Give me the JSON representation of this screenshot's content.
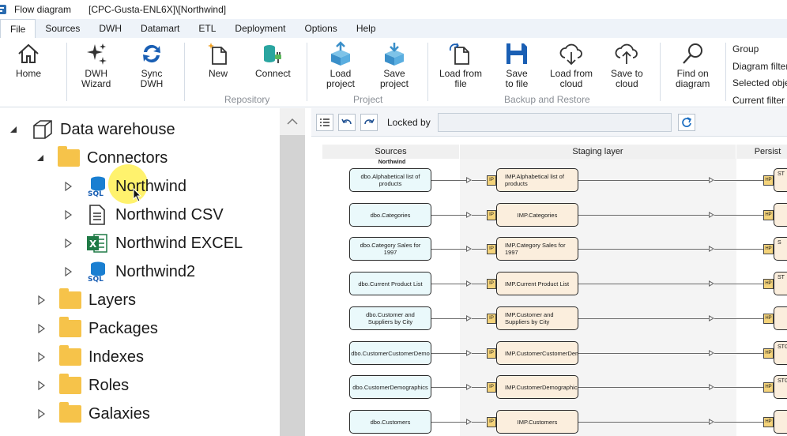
{
  "titlebar": {
    "title": "Flow diagram",
    "path": "[CPC-Gusta-ENL6X]\\[Northwind]"
  },
  "menu": {
    "tabs": [
      "File",
      "Sources",
      "DWH",
      "Datamart",
      "ETL",
      "Deployment",
      "Options",
      "Help"
    ],
    "active": "File"
  },
  "ribbon": {
    "buttons": {
      "home": [
        "Home"
      ],
      "dwh_wizard": [
        "DWH",
        "Wizard"
      ],
      "sync_dwh": [
        "Sync",
        "DWH"
      ],
      "new": [
        "New"
      ],
      "connect": [
        "Connect"
      ],
      "load_project": [
        "Load",
        "project"
      ],
      "save_project": [
        "Save",
        "project"
      ],
      "load_from_file": [
        "Load from",
        "file"
      ],
      "save_to_file": [
        "Save",
        "to file"
      ],
      "load_from_cloud": [
        "Load from",
        "cloud"
      ],
      "save_to_cloud": [
        "Save to",
        "cloud"
      ],
      "find_on_diagram": [
        "Find on",
        "diagram"
      ]
    },
    "groups": {
      "repository": "Repository",
      "project": "Project",
      "backup": "Backup and Restore"
    },
    "right_list": [
      "Group",
      "Diagram filter",
      "Selected objects",
      "Current filter"
    ],
    "accent": "#1a5fb4"
  },
  "tree": {
    "root": "Data warehouse",
    "connectors": "Connectors",
    "children": [
      {
        "label": "Northwind",
        "icon": "sql-database-icon"
      },
      {
        "label": "Northwind CSV",
        "icon": "csv-file-icon"
      },
      {
        "label": "Northwind EXCEL",
        "icon": "excel-file-icon"
      },
      {
        "label": "Northwind2",
        "icon": "sql-database-icon"
      }
    ],
    "folders": [
      "Layers",
      "Packages",
      "Indexes",
      "Roles",
      "Galaxies"
    ],
    "folder_color": "#f6c34a"
  },
  "diagram_toolbar": {
    "locked_by_label": "Locked by",
    "locked_by_value": ""
  },
  "diagram": {
    "lanes": [
      "Sources",
      "Staging layer",
      "Persist"
    ],
    "source_group": "Northwind",
    "rows": [
      {
        "source": "dbo.Alphabetical list of products",
        "staging": "IMP.Alphabetical list of products",
        "persist": "ST"
      },
      {
        "source": "dbo.Categories",
        "staging": "IMP.Categories",
        "persist": ""
      },
      {
        "source": "dbo.Category Sales for 1997",
        "staging": "IMP.Category Sales for 1997",
        "persist": "S"
      },
      {
        "source": "dbo.Current Product List",
        "staging": "IMP.Current Product List",
        "persist": "ST"
      },
      {
        "source": "dbo.Customer and Suppliers by City",
        "staging": "IMP.Customer and Suppliers by City",
        "persist": ""
      },
      {
        "source": "dbo.CustomerCustomerDemo",
        "staging": "IMP.CustomerCustomerDemo",
        "persist": "STG mo"
      },
      {
        "source": "dbo.CustomerDemographics",
        "staging": "IMP.CustomerDemographics",
        "persist": "STG cs"
      },
      {
        "source": "dbo.Customers",
        "staging": "IMP.Customers",
        "persist": ""
      }
    ],
    "badges": {
      "import": "IP",
      "persist": "HP"
    }
  }
}
